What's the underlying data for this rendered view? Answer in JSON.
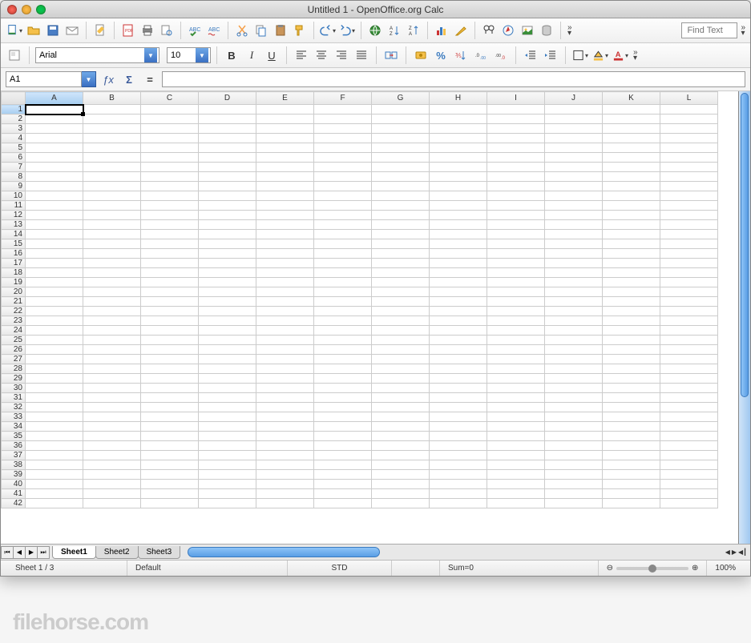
{
  "window": {
    "title": "Untitled 1 - OpenOffice.org Calc"
  },
  "toolbar1": {
    "find_placeholder": "Find Text"
  },
  "toolbar2": {
    "font_name": "Arial",
    "font_size": "10",
    "bold": "B",
    "italic": "I",
    "underline": "U"
  },
  "formula_bar": {
    "cell_ref": "A1",
    "fx": "ƒx",
    "sigma": "Σ",
    "eq": "=",
    "formula": ""
  },
  "grid": {
    "columns": [
      "A",
      "B",
      "C",
      "D",
      "E",
      "F",
      "G",
      "H",
      "I",
      "J",
      "K",
      "L"
    ],
    "rows": 42,
    "selected_cell": {
      "row": 1,
      "col": "A"
    }
  },
  "sheet_tabs": {
    "nav": [
      "⏮",
      "◀",
      "▶",
      "⏭"
    ],
    "tabs": [
      "Sheet1",
      "Sheet2",
      "Sheet3"
    ],
    "active": 0
  },
  "statusbar": {
    "sheet_pos": "Sheet 1 / 3",
    "style": "Default",
    "mode": "STD",
    "sum": "Sum=0",
    "zoom_minus": "⊖",
    "zoom_plus": "⊕",
    "zoom": "100%"
  },
  "watermark": "filehorse.com"
}
